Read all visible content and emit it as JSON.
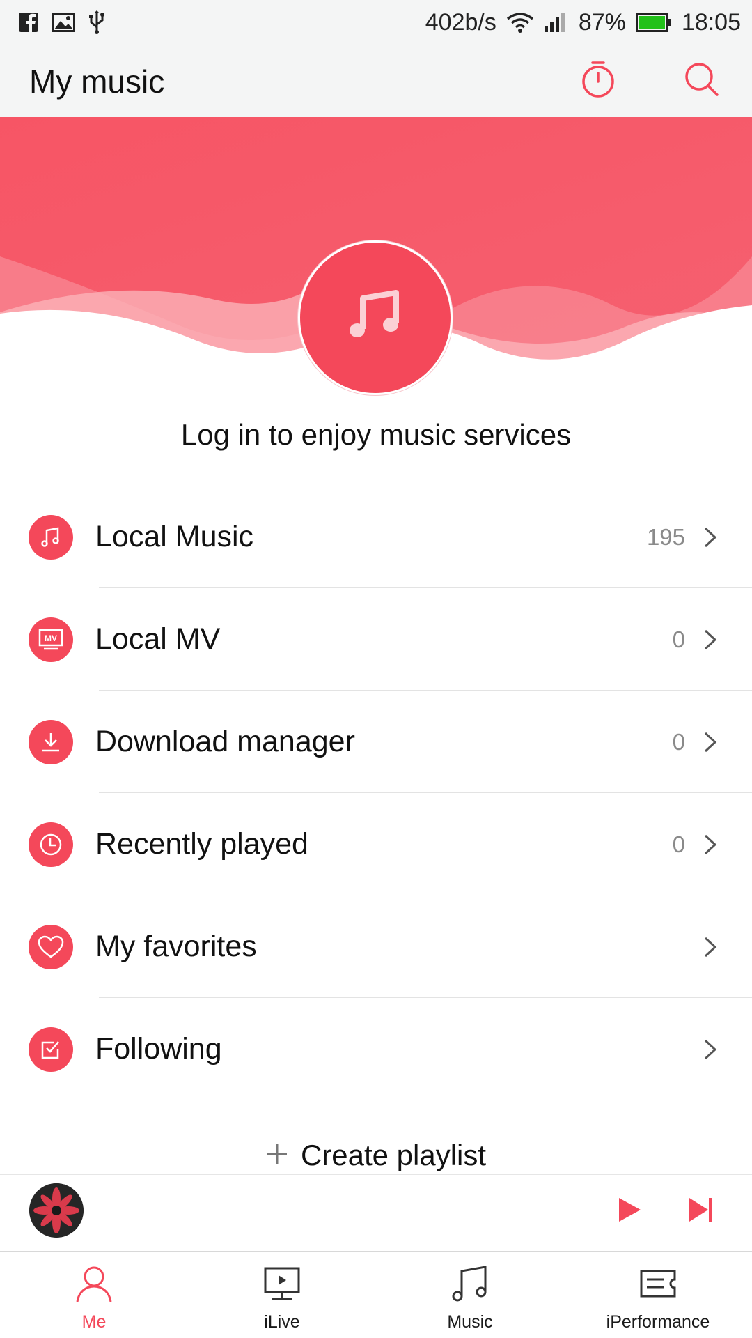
{
  "status_bar": {
    "left_icons": [
      "facebook-icon",
      "image-icon",
      "usb-icon"
    ],
    "network_speed": "402b/s",
    "battery_percent": "87%",
    "time": "18:05"
  },
  "header": {
    "title": "My music",
    "icons": [
      "timer-icon",
      "search-icon"
    ]
  },
  "profile": {
    "login_prompt": "Log in to enjoy music services"
  },
  "menu": {
    "items": [
      {
        "label": "Local Music",
        "count": "195",
        "icon": "music-note-icon"
      },
      {
        "label": "Local MV",
        "count": "0",
        "icon": "mv-icon"
      },
      {
        "label": "Download manager",
        "count": "0",
        "icon": "download-icon"
      },
      {
        "label": "Recently played",
        "count": "0",
        "icon": "clock-icon"
      },
      {
        "label": "My favorites",
        "count": "",
        "icon": "heart-icon"
      },
      {
        "label": "Following",
        "count": "",
        "icon": "checkbox-icon"
      }
    ]
  },
  "playlist": {
    "create_label": "Create playlist"
  },
  "player": {
    "controls": [
      "play-icon",
      "next-icon"
    ]
  },
  "tabs": {
    "items": [
      {
        "label": "Me",
        "icon": "person-icon",
        "active": true
      },
      {
        "label": "iLive",
        "icon": "video-icon",
        "active": false
      },
      {
        "label": "Music",
        "icon": "music-icon",
        "active": false
      },
      {
        "label": "iPerformance",
        "icon": "ticket-icon",
        "active": false
      }
    ]
  },
  "colors": {
    "accent": "#f4485a",
    "banner": "#f65868",
    "status_bg": "#f4f5f5",
    "battery": "#22c11a"
  }
}
